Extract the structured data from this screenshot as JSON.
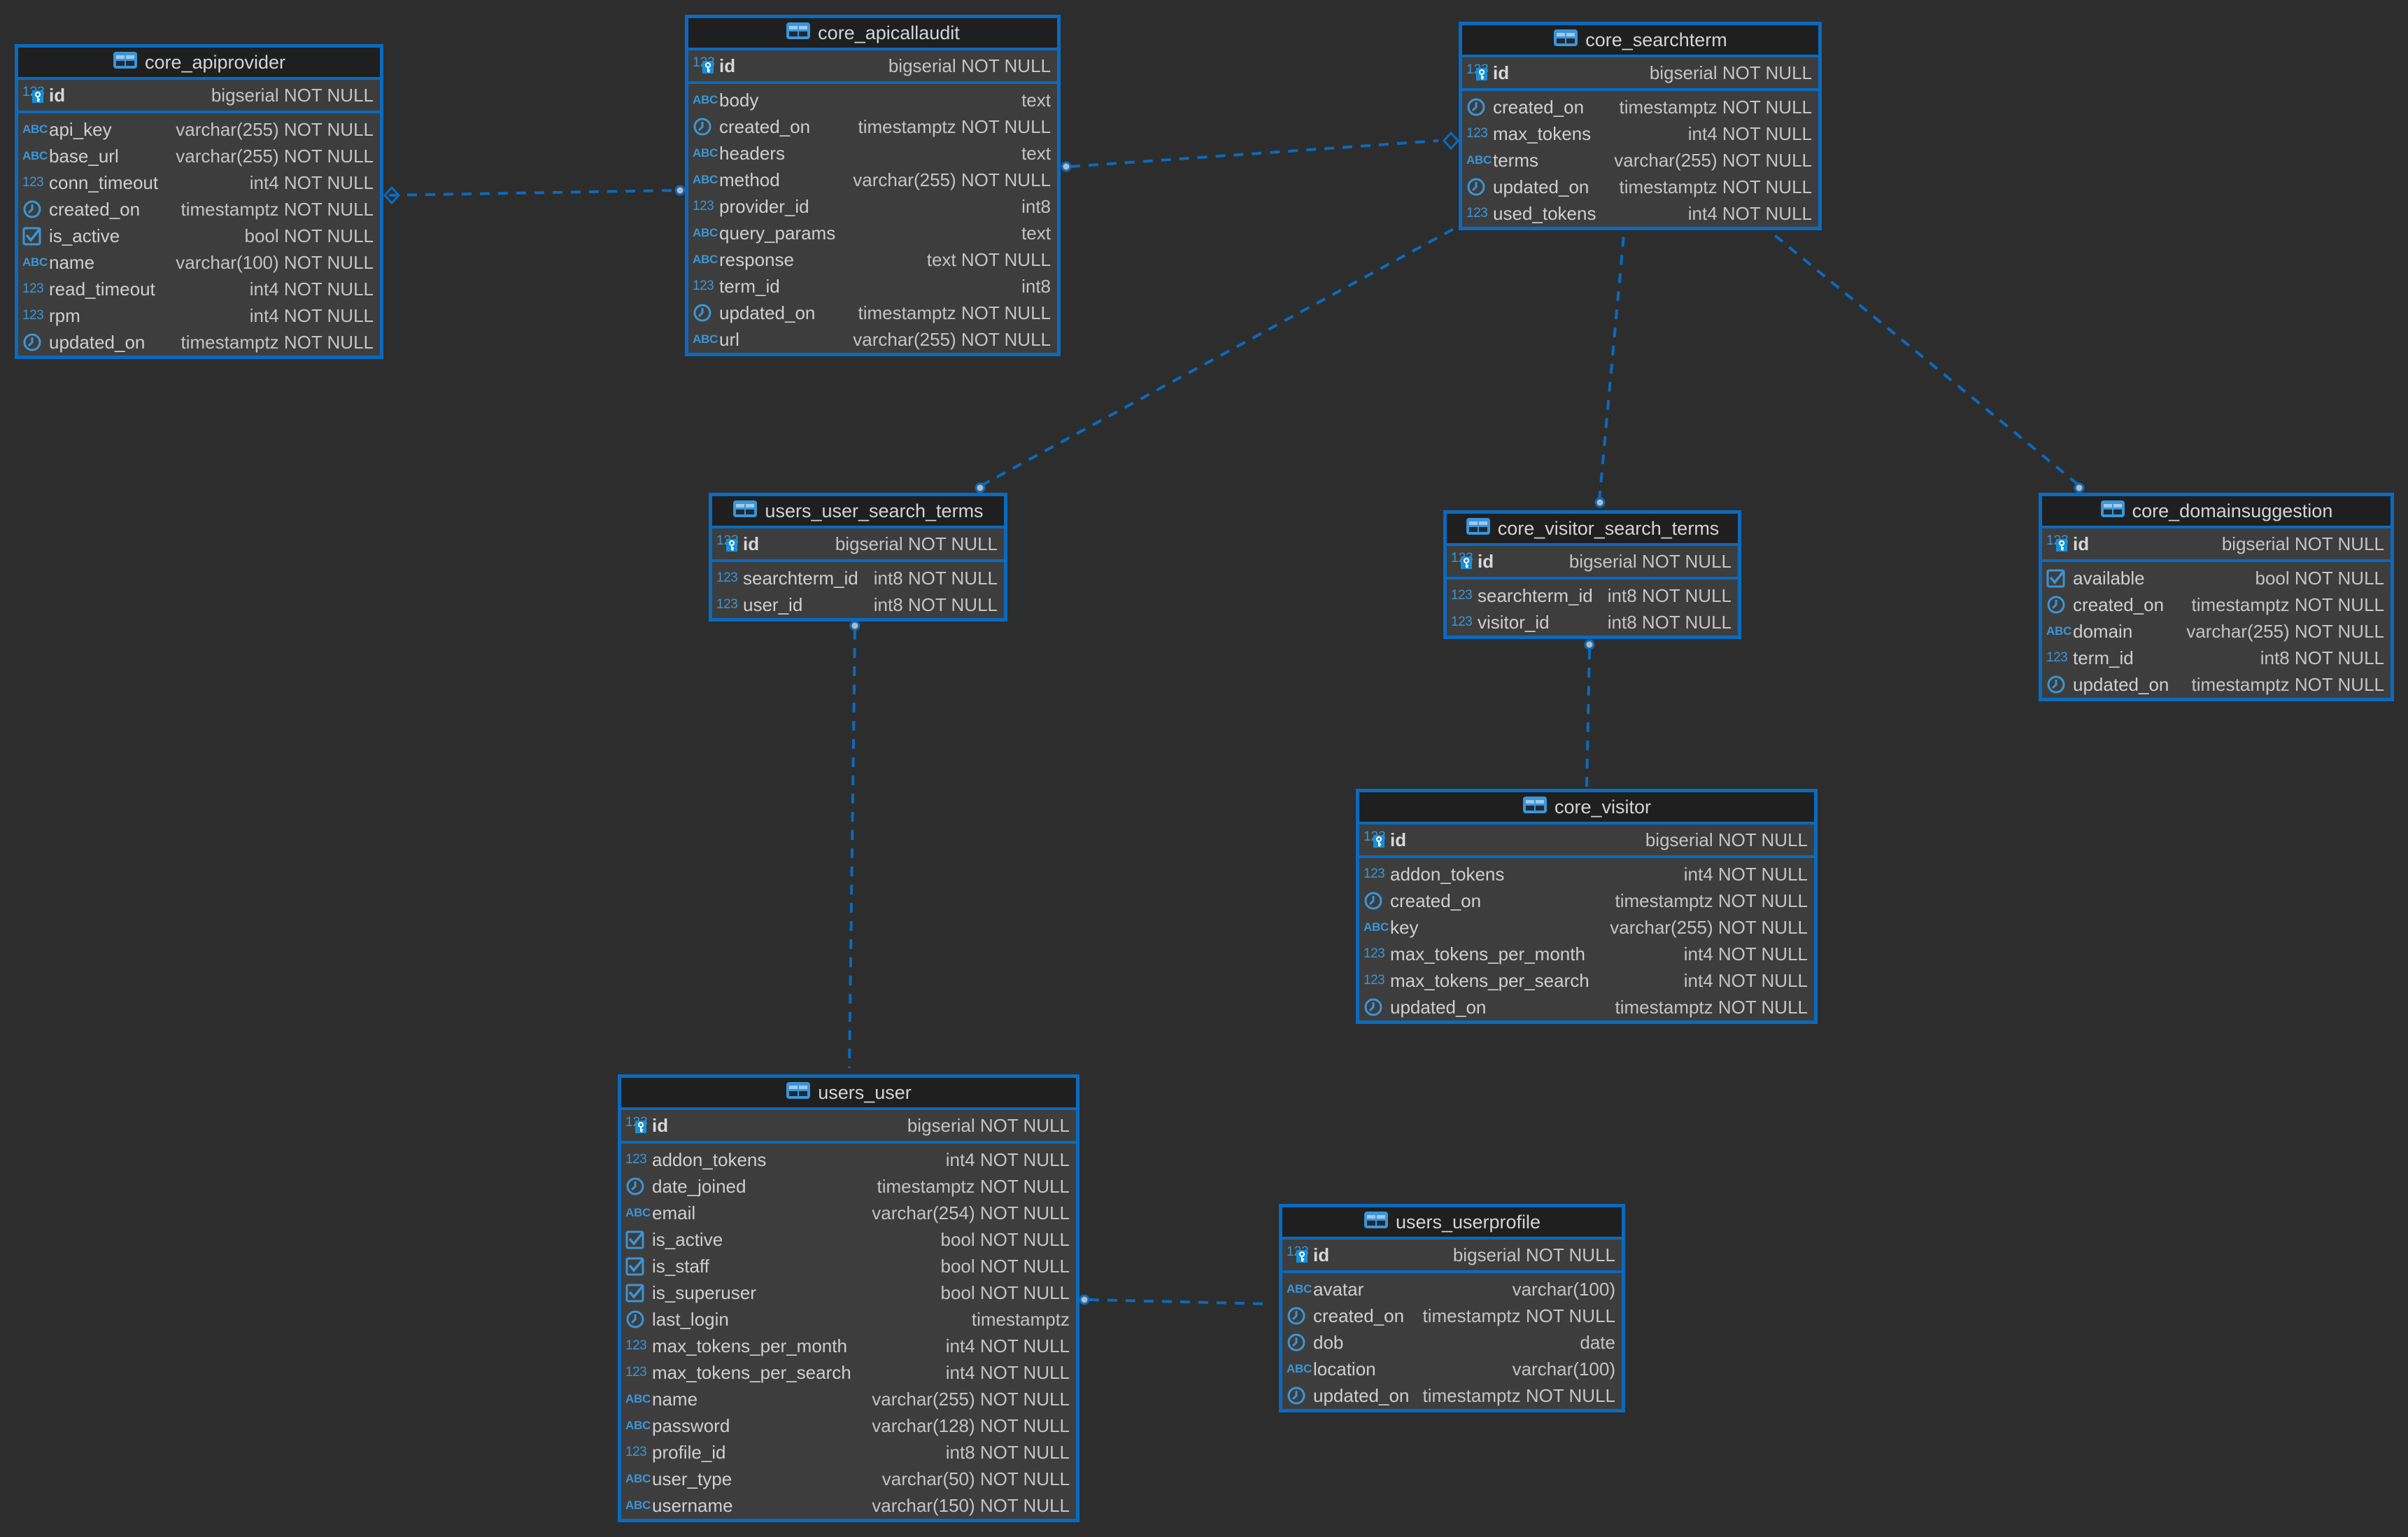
{
  "diagram": {
    "type": "entity-relationship",
    "colors": {
      "background": "#2d2d2d",
      "table_border": "#0b6abd",
      "header_bg": "#1f1f1f",
      "body_bg": "#3d3d3d",
      "icon": "#3b95d6",
      "link": "#0b6abd",
      "endpoint_fill": "#b8b8b8"
    }
  },
  "tables": [
    {
      "name": "core_apiprovider",
      "pk": {
        "name": "id",
        "type": "bigserial NOT NULL",
        "icon": "primary-key-icon"
      },
      "columns": [
        {
          "icon": "text-icon",
          "name": "api_key",
          "type": "varchar(255) NOT NULL"
        },
        {
          "icon": "text-icon",
          "name": "base_url",
          "type": "varchar(255) NOT NULL"
        },
        {
          "icon": "number-icon",
          "name": "conn_timeout",
          "type": "int4 NOT NULL"
        },
        {
          "icon": "clock-icon",
          "name": "created_on",
          "type": "timestamptz NOT NULL"
        },
        {
          "icon": "checkbox-icon",
          "name": "is_active",
          "type": "bool NOT NULL"
        },
        {
          "icon": "text-icon",
          "name": "name",
          "type": "varchar(100) NOT NULL"
        },
        {
          "icon": "number-icon",
          "name": "read_timeout",
          "type": "int4 NOT NULL"
        },
        {
          "icon": "number-icon",
          "name": "rpm",
          "type": "int4 NOT NULL"
        },
        {
          "icon": "clock-icon",
          "name": "updated_on",
          "type": "timestamptz NOT NULL"
        }
      ]
    },
    {
      "name": "core_apicallaudit",
      "pk": {
        "name": "id",
        "type": "bigserial NOT NULL",
        "icon": "primary-key-icon"
      },
      "columns": [
        {
          "icon": "text-icon",
          "name": "body",
          "type": "text"
        },
        {
          "icon": "clock-icon",
          "name": "created_on",
          "type": "timestamptz NOT NULL"
        },
        {
          "icon": "text-icon",
          "name": "headers",
          "type": "text"
        },
        {
          "icon": "text-icon",
          "name": "method",
          "type": "varchar(255) NOT NULL"
        },
        {
          "icon": "number-icon",
          "name": "provider_id",
          "type": "int8"
        },
        {
          "icon": "text-icon",
          "name": "query_params",
          "type": "text"
        },
        {
          "icon": "text-icon",
          "name": "response",
          "type": "text NOT NULL"
        },
        {
          "icon": "number-icon",
          "name": "term_id",
          "type": "int8"
        },
        {
          "icon": "clock-icon",
          "name": "updated_on",
          "type": "timestamptz NOT NULL"
        },
        {
          "icon": "text-icon",
          "name": "url",
          "type": "varchar(255) NOT NULL"
        }
      ]
    },
    {
      "name": "core_searchterm",
      "pk": {
        "name": "id",
        "type": "bigserial NOT NULL",
        "icon": "primary-key-icon"
      },
      "columns": [
        {
          "icon": "clock-icon",
          "name": "created_on",
          "type": "timestamptz NOT NULL"
        },
        {
          "icon": "number-icon",
          "name": "max_tokens",
          "type": "int4 NOT NULL"
        },
        {
          "icon": "text-icon",
          "name": "terms",
          "type": "varchar(255) NOT NULL"
        },
        {
          "icon": "clock-icon",
          "name": "updated_on",
          "type": "timestamptz NOT NULL"
        },
        {
          "icon": "number-icon",
          "name": "used_tokens",
          "type": "int4 NOT NULL"
        }
      ]
    },
    {
      "name": "users_user_search_terms",
      "pk": {
        "name": "id",
        "type": "bigserial NOT NULL",
        "icon": "primary-key-icon"
      },
      "columns": [
        {
          "icon": "number-icon",
          "name": "searchterm_id",
          "type": "int8 NOT NULL"
        },
        {
          "icon": "number-icon",
          "name": "user_id",
          "type": "int8 NOT NULL"
        }
      ]
    },
    {
      "name": "core_visitor_search_terms",
      "pk": {
        "name": "id",
        "type": "bigserial NOT NULL",
        "icon": "primary-key-icon"
      },
      "columns": [
        {
          "icon": "number-icon",
          "name": "searchterm_id",
          "type": "int8 NOT NULL"
        },
        {
          "icon": "number-icon",
          "name": "visitor_id",
          "type": "int8 NOT NULL"
        }
      ]
    },
    {
      "name": "core_domainsuggestion",
      "pk": {
        "name": "id",
        "type": "bigserial NOT NULL",
        "icon": "primary-key-icon"
      },
      "columns": [
        {
          "icon": "checkbox-icon",
          "name": "available",
          "type": "bool NOT NULL"
        },
        {
          "icon": "clock-icon",
          "name": "created_on",
          "type": "timestamptz NOT NULL"
        },
        {
          "icon": "text-icon",
          "name": "domain",
          "type": "varchar(255) NOT NULL"
        },
        {
          "icon": "number-icon",
          "name": "term_id",
          "type": "int8 NOT NULL"
        },
        {
          "icon": "clock-icon",
          "name": "updated_on",
          "type": "timestamptz NOT NULL"
        }
      ]
    },
    {
      "name": "core_visitor",
      "pk": {
        "name": "id",
        "type": "bigserial NOT NULL",
        "icon": "primary-key-icon"
      },
      "columns": [
        {
          "icon": "number-icon",
          "name": "addon_tokens",
          "type": "int4 NOT NULL"
        },
        {
          "icon": "clock-icon",
          "name": "created_on",
          "type": "timestamptz NOT NULL"
        },
        {
          "icon": "text-icon",
          "name": "key",
          "type": "varchar(255) NOT NULL"
        },
        {
          "icon": "number-icon",
          "name": "max_tokens_per_month",
          "type": "int4 NOT NULL"
        },
        {
          "icon": "number-icon",
          "name": "max_tokens_per_search",
          "type": "int4 NOT NULL"
        },
        {
          "icon": "clock-icon",
          "name": "updated_on",
          "type": "timestamptz NOT NULL"
        }
      ]
    },
    {
      "name": "users_user",
      "pk": {
        "name": "id",
        "type": "bigserial NOT NULL",
        "icon": "primary-key-icon"
      },
      "columns": [
        {
          "icon": "number-icon",
          "name": "addon_tokens",
          "type": "int4 NOT NULL"
        },
        {
          "icon": "clock-icon",
          "name": "date_joined",
          "type": "timestamptz NOT NULL"
        },
        {
          "icon": "text-icon",
          "name": "email",
          "type": "varchar(254) NOT NULL"
        },
        {
          "icon": "checkbox-icon",
          "name": "is_active",
          "type": "bool NOT NULL"
        },
        {
          "icon": "checkbox-icon",
          "name": "is_staff",
          "type": "bool NOT NULL"
        },
        {
          "icon": "checkbox-icon",
          "name": "is_superuser",
          "type": "bool NOT NULL"
        },
        {
          "icon": "clock-icon",
          "name": "last_login",
          "type": "timestamptz"
        },
        {
          "icon": "number-icon",
          "name": "max_tokens_per_month",
          "type": "int4 NOT NULL"
        },
        {
          "icon": "number-icon",
          "name": "max_tokens_per_search",
          "type": "int4 NOT NULL"
        },
        {
          "icon": "text-icon",
          "name": "name",
          "type": "varchar(255) NOT NULL"
        },
        {
          "icon": "text-icon",
          "name": "password",
          "type": "varchar(128) NOT NULL"
        },
        {
          "icon": "number-icon",
          "name": "profile_id",
          "type": "int8 NOT NULL"
        },
        {
          "icon": "text-icon",
          "name": "user_type",
          "type": "varchar(50) NOT NULL"
        },
        {
          "icon": "text-icon",
          "name": "username",
          "type": "varchar(150) NOT NULL"
        }
      ]
    },
    {
      "name": "users_userprofile",
      "pk": {
        "name": "id",
        "type": "bigserial NOT NULL",
        "icon": "primary-key-icon"
      },
      "columns": [
        {
          "icon": "text-icon",
          "name": "avatar",
          "type": "varchar(100)"
        },
        {
          "icon": "clock-icon",
          "name": "created_on",
          "type": "timestamptz NOT NULL"
        },
        {
          "icon": "clock-icon",
          "name": "dob",
          "type": "date"
        },
        {
          "icon": "text-icon",
          "name": "location",
          "type": "varchar(100)"
        },
        {
          "icon": "clock-icon",
          "name": "updated_on",
          "type": "timestamptz NOT NULL"
        }
      ]
    }
  ],
  "relationships": [
    {
      "from": "core_apicallaudit",
      "to": "core_apiprovider",
      "from_end": "circle",
      "to_end": "diamond"
    },
    {
      "from": "core_apicallaudit",
      "to": "core_searchterm",
      "from_end": "circle",
      "to_end": "diamond"
    },
    {
      "from": "users_user_search_terms",
      "to": "core_searchterm",
      "from_end": "circle",
      "to_end": "none"
    },
    {
      "from": "core_visitor_search_terms",
      "to": "core_searchterm",
      "from_end": "circle",
      "to_end": "none"
    },
    {
      "from": "core_domainsuggestion",
      "to": "core_searchterm",
      "from_end": "circle",
      "to_end": "none"
    },
    {
      "from": "users_user_search_terms",
      "to": "users_user",
      "from_end": "circle",
      "to_end": "none"
    },
    {
      "from": "core_visitor_search_terms",
      "to": "core_visitor",
      "from_end": "circle",
      "to_end": "none"
    },
    {
      "from": "users_user",
      "to": "users_userprofile",
      "from_end": "circle",
      "to_end": "none"
    }
  ]
}
